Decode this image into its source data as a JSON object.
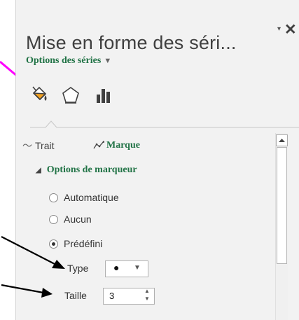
{
  "pane": {
    "title": "Mise en forme des séri...",
    "dropdown_glyph": "▾",
    "close_glyph": "✕",
    "series_options_label": "Options des séries",
    "series_options_caret": "▼"
  },
  "icon_tabs": [
    {
      "name": "fill-line-icon",
      "selected": true
    },
    {
      "name": "effects-pentagon-icon",
      "selected": false
    },
    {
      "name": "series-options-chart-icon",
      "selected": false
    }
  ],
  "subtabs": {
    "line_label": "Trait",
    "marker_label": "Marque",
    "selected": "Marque"
  },
  "marker_options": {
    "section_label": "Options de marqueur",
    "expand_glyph": "◢",
    "radios": [
      {
        "label": "Automatique",
        "checked": false
      },
      {
        "label": "Aucun",
        "checked": false
      },
      {
        "label": "Prédéfini",
        "checked": true
      }
    ],
    "type_label": "Type",
    "type_value": "●",
    "size_label": "Taille",
    "size_value": "3"
  },
  "colors": {
    "accent_green": "#217346",
    "annotation_magenta": "#ff00ff",
    "pane_bg": "#f2f2f2",
    "fill_icon_orange": "#f0a020"
  }
}
